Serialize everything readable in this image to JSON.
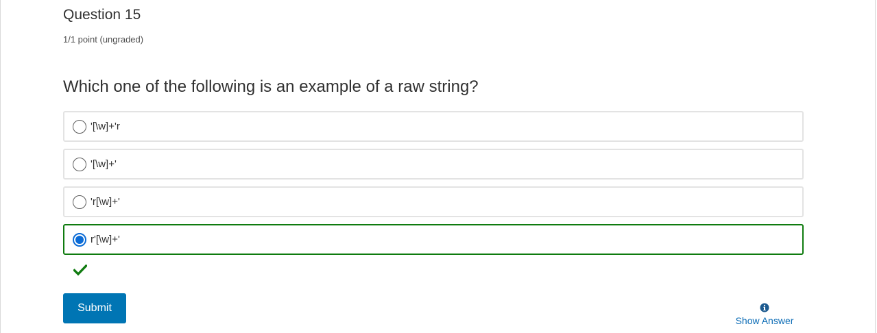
{
  "problem": {
    "title": "Question 15",
    "points": "1/1 point (ungraded)",
    "prompt": "Which one of the following is an example of a raw string?",
    "choices": [
      {
        "label": "'[\\w]+'r",
        "selected": false
      },
      {
        "label": "'[\\w]+'",
        "selected": false
      },
      {
        "label": "'r[\\w]+'",
        "selected": false
      },
      {
        "label": "r'[\\w]+'",
        "selected": true
      }
    ],
    "status_icon": "checkmark-icon",
    "status_color": "#0f7b0f"
  },
  "actions": {
    "submit_label": "Submit",
    "show_answer_label": "Show Answer",
    "show_answer_icon": "info-icon",
    "submit_color": "#0075b4",
    "selected_color": "#0a6bd6"
  }
}
